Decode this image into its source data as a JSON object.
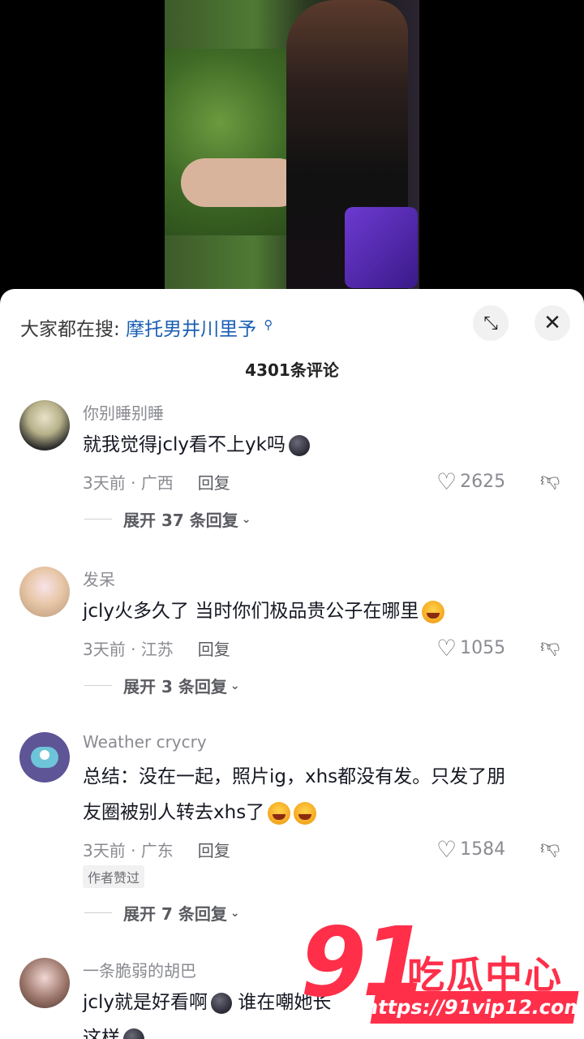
{
  "search": {
    "prefix": "大家都在搜:",
    "term": "摩托男井川里予",
    "icon": "search-icon"
  },
  "header": {
    "comment_count": "4301条评论",
    "expand_icon": "⤡",
    "close_icon": "✕"
  },
  "comments": [
    {
      "username": "你别睡别睡",
      "text": "就我觉得jcly看不上yk吗",
      "time_location": "3天前 · 广西",
      "reply_label": "回复",
      "likes": "2625",
      "expand_label": "展开 37 条回复"
    },
    {
      "username": "发呆",
      "text": "jcly火多久了 当时你们极品贵公子在哪里",
      "time_location": "3天前 · 江苏",
      "reply_label": "回复",
      "likes": "1055",
      "expand_label": "展开 3 条回复"
    },
    {
      "username": "Weather crycry",
      "text_line1": "总结：没在一起，照片ig，xhs都没有发。只发了朋",
      "text_line2": "友圈被别人转去xhs了",
      "time_location": "3天前 · 广东",
      "reply_label": "回复",
      "likes": "1584",
      "author_badge": "作者赞过",
      "expand_label": "展开 7 条回复"
    },
    {
      "username": "一条脆弱的胡巴",
      "text_line1": "jcly就是好看啊",
      "text_line1b": "谁在嘲她长",
      "text_line2": "这样"
    }
  ],
  "watermark": {
    "number": "91",
    "name": "吃瓜中心",
    "url": "https://91vip12.com"
  },
  "colors": {
    "search_term": "#1a5fb4",
    "watermark": "#ff2f4a"
  }
}
